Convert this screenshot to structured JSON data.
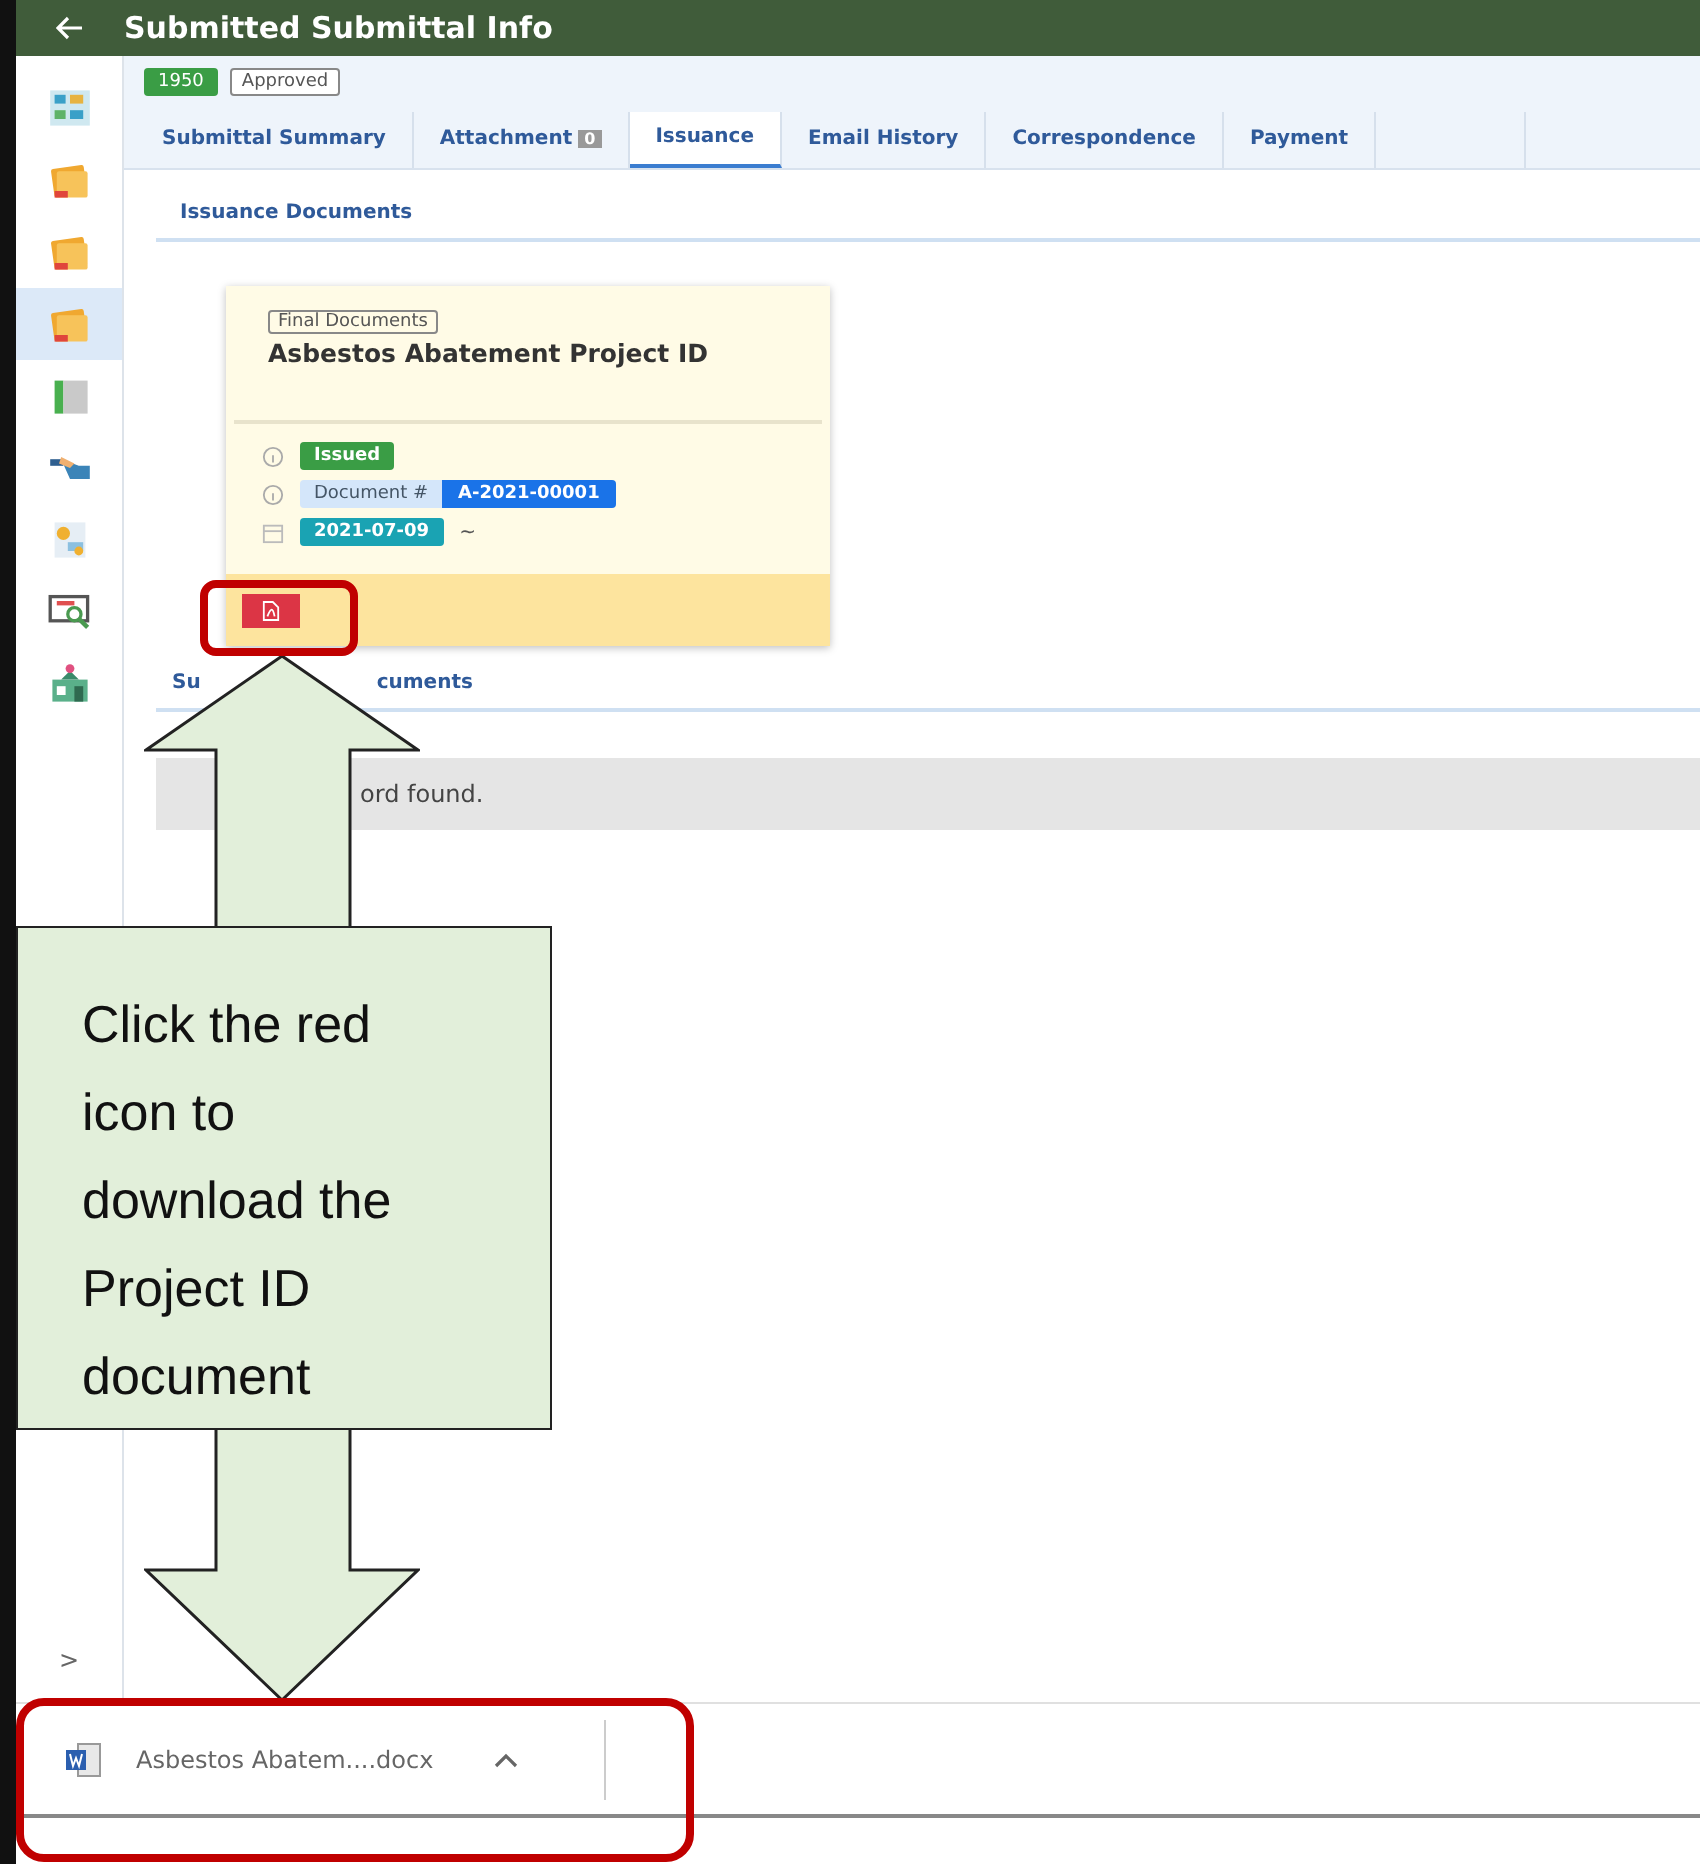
{
  "header": {
    "title": "Submitted Submittal Info"
  },
  "sidebar": {
    "items": [
      {
        "selected": false
      },
      {
        "selected": false
      },
      {
        "selected": false
      },
      {
        "selected": true
      },
      {
        "selected": false
      },
      {
        "selected": false
      },
      {
        "selected": false
      },
      {
        "selected": false
      },
      {
        "selected": false
      }
    ],
    "expand_toggle": ">"
  },
  "record": {
    "number": "1950",
    "status": "Approved"
  },
  "tabs": [
    {
      "label": "Submittal Summary",
      "selected": false
    },
    {
      "label": "Attachment",
      "count": "0",
      "selected": false
    },
    {
      "label": "Issuance",
      "selected": true
    },
    {
      "label": "Email History",
      "selected": false
    },
    {
      "label": "Correspondence",
      "selected": false
    },
    {
      "label": "Payment",
      "selected": false
    }
  ],
  "issuance_documents": {
    "heading": "Issuance Documents",
    "cards": [
      {
        "category": "Final Documents",
        "title": "Asbestos Abatement Project ID",
        "status": "Issued",
        "document_label": "Document #",
        "document_number": "A-2021-00001",
        "date": "2021-07-09",
        "date_suffix": "~"
      }
    ]
  },
  "submittal_documents": {
    "heading_parts": [
      "Su",
      "cuments"
    ],
    "empty_message": "ord found."
  },
  "download_bar": {
    "file_name": "Asbestos Abatem....docx"
  },
  "annotation": {
    "callout": "Click the red icon to download the Project ID document"
  }
}
